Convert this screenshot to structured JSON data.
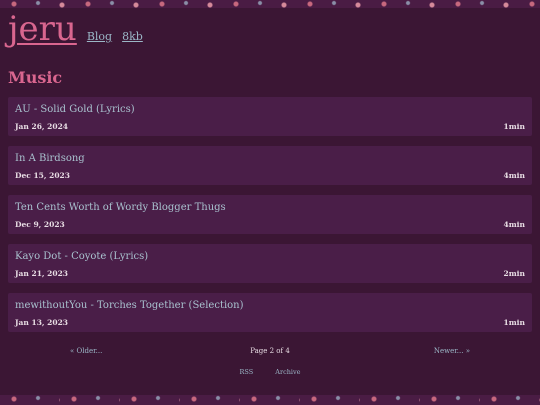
{
  "site": {
    "logo": "jeru",
    "nav": [
      "Blog",
      "8kb"
    ]
  },
  "page_title": "Music",
  "posts": [
    {
      "title": "AU - Solid Gold (Lyrics)",
      "date": "Jan 26, 2024",
      "read": "1min"
    },
    {
      "title": "In A Birdsong",
      "date": "Dec 15, 2023",
      "read": "4min"
    },
    {
      "title": "Ten Cents Worth of Wordy Blogger Thugs",
      "date": "Dec 9, 2023",
      "read": "4min"
    },
    {
      "title": "Kayo Dot - Coyote (Lyrics)",
      "date": "Jan 21, 2023",
      "read": "2min"
    },
    {
      "title": "mewithoutYou - Torches Together (Selection)",
      "date": "Jan 13, 2023",
      "read": "1min"
    }
  ],
  "pagination": {
    "older": "« Older...",
    "current": "Page 2 of 4",
    "newer": "Newer... »"
  },
  "footer": {
    "links": [
      "RSS",
      "Archive"
    ]
  }
}
